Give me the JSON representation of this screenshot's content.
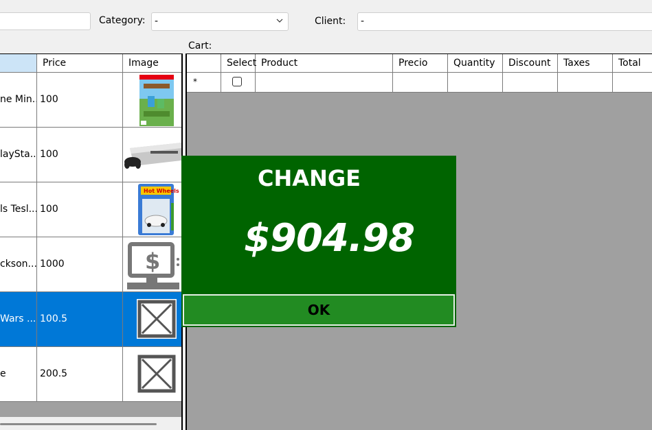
{
  "filters": {
    "search_value": "",
    "category_label": "Category:",
    "category_value": "-",
    "client_label": "Client:",
    "client_value": "-"
  },
  "products": {
    "columns": [
      "",
      "Price",
      "Image"
    ],
    "rows": [
      {
        "name": "ne Min...",
        "price": "100",
        "image": "minecraft-box-art",
        "selected": false
      },
      {
        "name": "laySta...",
        "price": "100",
        "image": "playstation-console",
        "selected": false
      },
      {
        "name": "ls Tesl...",
        "price": "100",
        "image": "hot-wheels-tesla-toy",
        "selected": false
      },
      {
        "name": "ckson...",
        "price": "1000",
        "image": "monitor-dollar-icon",
        "selected": false
      },
      {
        "name": "Wars ...",
        "price": "100.5",
        "image": "missing-image-icon",
        "selected": true
      },
      {
        "name": "e",
        "price": "200.5",
        "image": "missing-image-icon",
        "selected": false
      }
    ]
  },
  "cart": {
    "label": "Cart:",
    "columns": [
      "Select",
      "Product",
      "Precio",
      "Quantity",
      "Discount",
      "Taxes",
      "Total"
    ],
    "new_row_marker": "*"
  },
  "change_dialog": {
    "title": "CHANGE",
    "amount": "$904.98",
    "ok_label": "OK"
  },
  "colors": {
    "dialog_bg": "#006400",
    "ok_button_bg": "#228b22",
    "selection_blue": "#0078d7",
    "grid_empty": "#a0a0a0"
  }
}
